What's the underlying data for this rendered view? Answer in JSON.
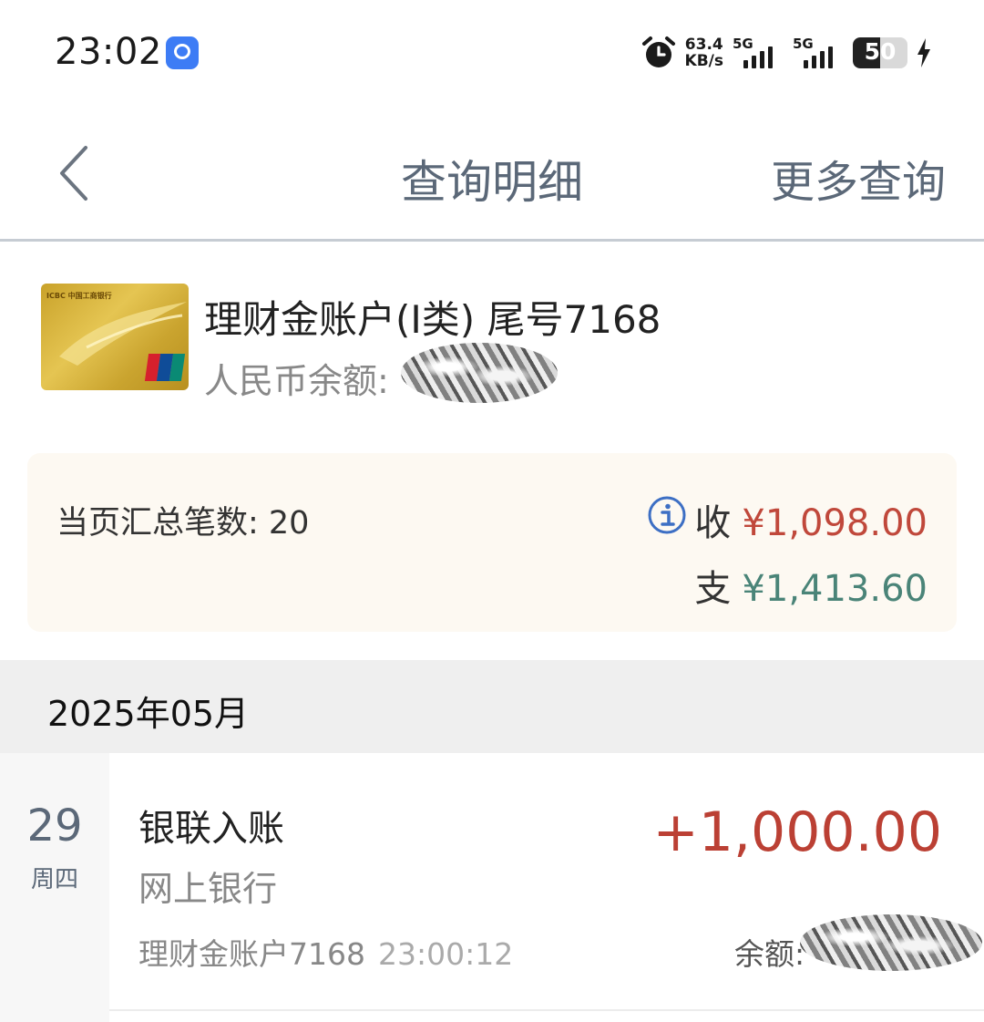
{
  "status_bar": {
    "time": "23:02",
    "net_speed_value": "63.4",
    "net_speed_unit": "KB/s",
    "sim1_label": "5G",
    "sim2_label": "5G",
    "battery_level": "50",
    "battery_fraction": 0.5
  },
  "nav": {
    "title": "查询明细",
    "more_label": "更多查询"
  },
  "account": {
    "card_brand_text": "ICBC 中国工商银行",
    "name": "理财金账户(Ⅰ类) 尾号7168",
    "balance_label": "人民币余额:"
  },
  "summary": {
    "count_text": "当页汇总笔数: 20",
    "income_label": "收",
    "income_amount": "¥1,098.00",
    "expense_label": "支",
    "expense_amount": "¥1,413.60"
  },
  "month": {
    "label": "2025年05月"
  },
  "transactions": [
    {
      "day": "29",
      "weekday": "周四",
      "title": "银联入账",
      "channel": "网上银行",
      "amount": "+1,000.00",
      "account": "理财金账户7168",
      "time": "23:00:12",
      "balance_label": "余额:"
    }
  ],
  "colors": {
    "income": "#c0483b",
    "expense": "#4a8478",
    "nav_text": "#5b6878",
    "summary_bg": "#fdf9f2",
    "month_bg": "#efefef"
  },
  "icons": [
    "alarm-icon",
    "bolt-icon",
    "back-arrow-icon",
    "info-icon",
    "unionpay-logo-icon"
  ]
}
